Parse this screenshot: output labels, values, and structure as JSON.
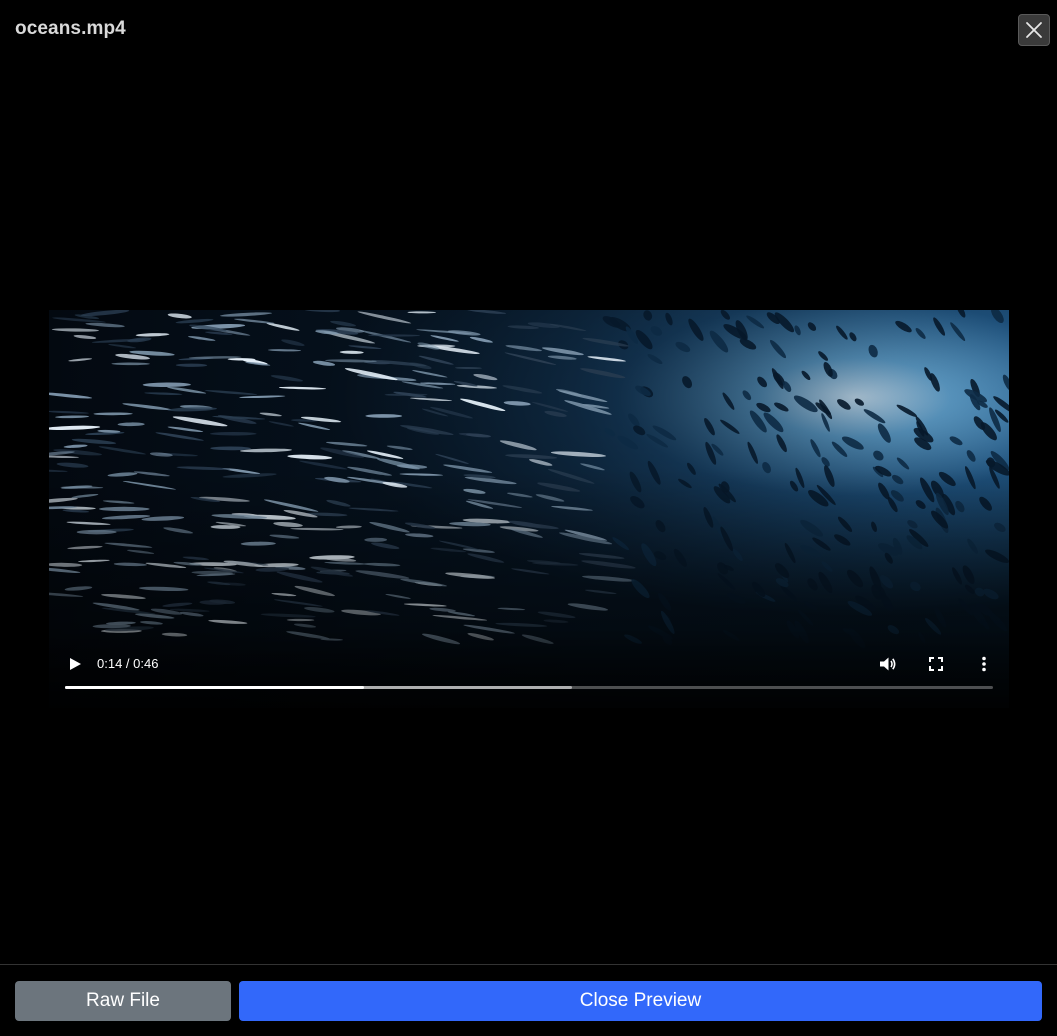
{
  "modal": {
    "title": "oceans.mp4"
  },
  "video": {
    "current_time": "0:14",
    "duration": "0:46",
    "time_display": "0:14 / 0:46",
    "played_fraction": 0.322,
    "buffered_fraction": 0.546,
    "state": "paused"
  },
  "footer": {
    "raw_file_label": "Raw File",
    "close_preview_label": "Close Preview"
  },
  "colors": {
    "background": "#000000",
    "primary_button": "#3268fa",
    "secondary_button": "#6c757d",
    "title_text": "#d9d9d9"
  },
  "icons": {
    "close": "close-icon",
    "play": "play-icon",
    "volume": "volume-icon",
    "fullscreen": "fullscreen-icon",
    "more": "more-options-icon"
  }
}
